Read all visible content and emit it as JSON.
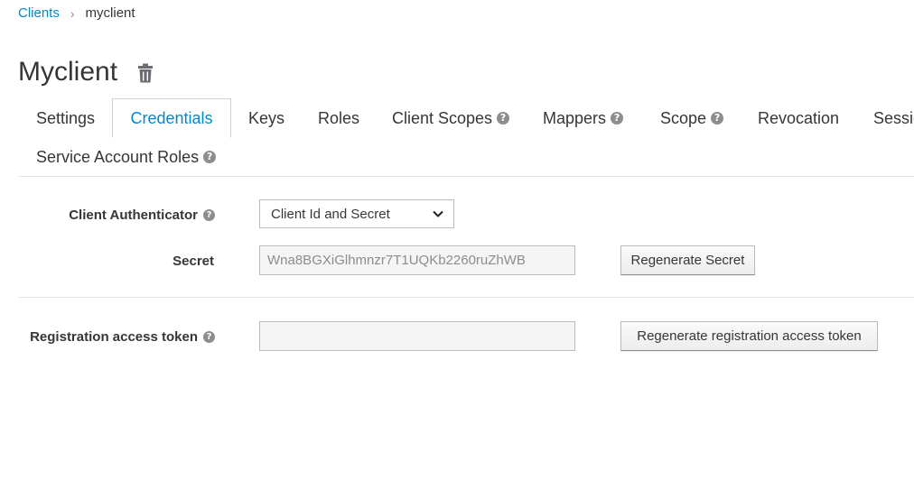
{
  "breadcrumb": {
    "parent": "Clients",
    "separator": "›",
    "current": "myclient"
  },
  "page": {
    "title": "Myclient",
    "delete_icon": "trash-icon"
  },
  "tabs": [
    {
      "label": "Settings",
      "active": false,
      "help": false
    },
    {
      "label": "Credentials",
      "active": true,
      "help": false
    },
    {
      "label": "Keys",
      "active": false,
      "help": false
    },
    {
      "label": "Roles",
      "active": false,
      "help": false
    },
    {
      "label": "Client Scopes",
      "active": false,
      "help": true
    },
    {
      "label": "Mappers",
      "active": false,
      "help": true
    },
    {
      "label": "Scope",
      "active": false,
      "help": true
    },
    {
      "label": "Revocation",
      "active": false,
      "help": false
    },
    {
      "label": "Sessio",
      "active": false,
      "help": false
    },
    {
      "label": "Service Account Roles",
      "active": false,
      "help": true
    }
  ],
  "help_glyph": "?",
  "form": {
    "client_authenticator": {
      "label": "Client Authenticator",
      "value": "Client Id and Secret"
    },
    "secret": {
      "label": "Secret",
      "value": "Wna8BGXiGlhmnzr7T1UQKb2260ruZhWB",
      "button": "Regenerate Secret"
    },
    "registration_token": {
      "label": "Registration access token",
      "value": "",
      "button": "Regenerate registration access token"
    }
  },
  "colors": {
    "accent": "#0088ce",
    "text": "#363636",
    "muted": "#8b8d8f",
    "border": "#d1d1d1"
  }
}
